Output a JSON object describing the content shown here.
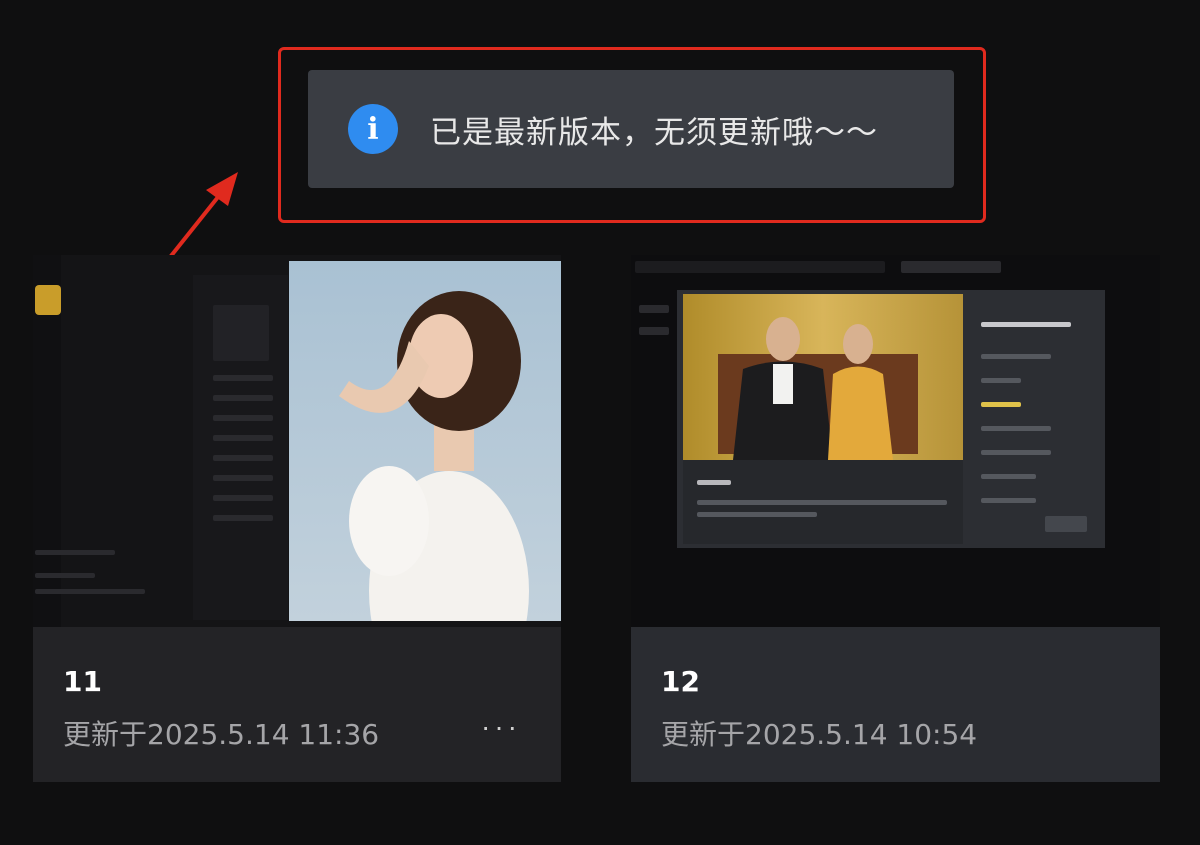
{
  "toast": {
    "icon": "info-icon",
    "text": "已是最新版本，无须更新哦～～",
    "highlight_color": "#e02a1e"
  },
  "cards": [
    {
      "title": "11",
      "updated": "更新于2025.5.14 11:36",
      "more": "···"
    },
    {
      "title": "12",
      "updated": "更新于2025.5.14 10:54"
    }
  ],
  "colors": {
    "accent": "#2f8cf0",
    "background": "#0f0f10"
  }
}
